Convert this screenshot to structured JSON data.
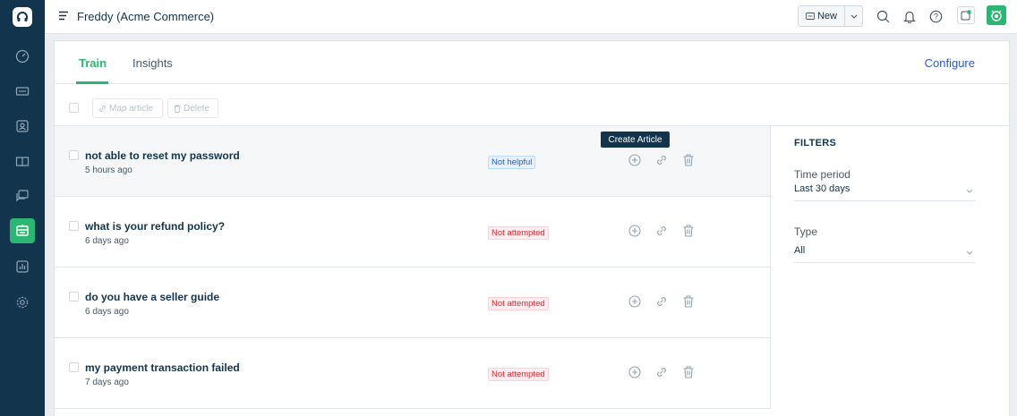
{
  "app": {
    "title": "Freddy (Acme Commerce)"
  },
  "header": {
    "new_label": "New"
  },
  "tabs": [
    {
      "label": "Train"
    },
    {
      "label": "Insights"
    }
  ],
  "configure_label": "Configure",
  "toolbar": {
    "map_label": "Map article",
    "delete_label": "Delete"
  },
  "tooltip": "Create Article",
  "questions": [
    {
      "text": "not able to reset my password",
      "time": "5 hours ago",
      "status": "Not helpful"
    },
    {
      "text": "what is your refund policy?",
      "time": "6 days ago",
      "status": "Not attempted"
    },
    {
      "text": "do you have a seller guide",
      "time": "6 days ago",
      "status": "Not attempted"
    },
    {
      "text": "my payment transaction failed",
      "time": "7 days ago",
      "status": "Not attempted"
    }
  ],
  "filters": {
    "heading": "FILTERS",
    "time_label": "Time period",
    "time_value": "Last 30 days",
    "type_label": "Type",
    "type_value": "All"
  },
  "colors": {
    "accent": "#2bb673",
    "sidebar": "#12344d",
    "link": "#2c5cc5",
    "danger": "#d72d30"
  }
}
